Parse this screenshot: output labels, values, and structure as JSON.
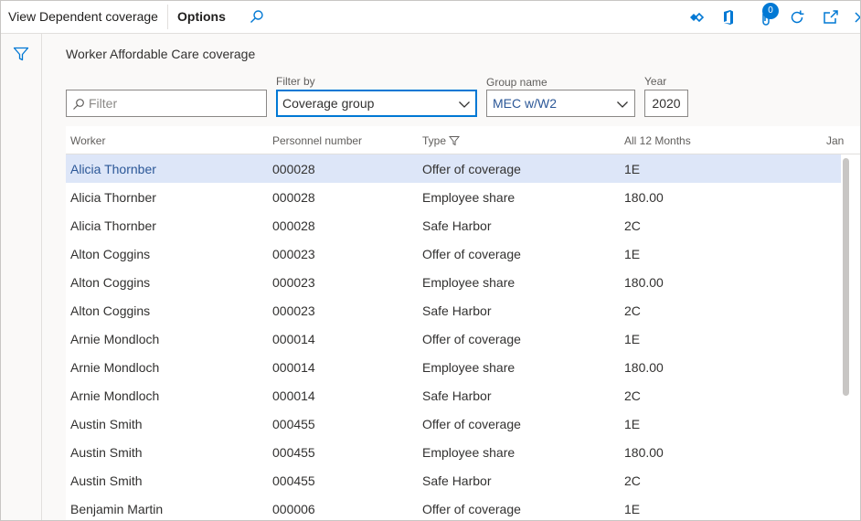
{
  "toolbar": {
    "view_dependent_label": "View Dependent coverage",
    "options_label": "Options",
    "attachments_count": "0"
  },
  "page": {
    "title": "Worker Affordable Care coverage"
  },
  "filters": {
    "filter_placeholder": "Filter",
    "filter_by_label": "Filter by",
    "filter_by_value": "Coverage group",
    "group_name_label": "Group name",
    "group_name_value": "MEC w/W2",
    "year_label": "Year",
    "year_value": "2020"
  },
  "grid": {
    "columns": [
      "Worker",
      "Personnel number",
      "Type",
      "All 12 Months",
      "Jan"
    ],
    "rows": [
      [
        "Alicia Thornber",
        "000028",
        "Offer of coverage",
        "1E"
      ],
      [
        "Alicia Thornber",
        "000028",
        "Employee share",
        "180.00"
      ],
      [
        "Alicia Thornber",
        "000028",
        "Safe Harbor",
        "2C"
      ],
      [
        "Alton Coggins",
        "000023",
        "Offer of coverage",
        "1E"
      ],
      [
        "Alton Coggins",
        "000023",
        "Employee share",
        "180.00"
      ],
      [
        "Alton Coggins",
        "000023",
        "Safe Harbor",
        "2C"
      ],
      [
        "Arnie Mondloch",
        "000014",
        "Offer of coverage",
        "1E"
      ],
      [
        "Arnie Mondloch",
        "000014",
        "Employee share",
        "180.00"
      ],
      [
        "Arnie Mondloch",
        "000014",
        "Safe Harbor",
        "2C"
      ],
      [
        "Austin Smith",
        "000455",
        "Offer of coverage",
        "1E"
      ],
      [
        "Austin Smith",
        "000455",
        "Employee share",
        "180.00"
      ],
      [
        "Austin Smith",
        "000455",
        "Safe Harbor",
        "2C"
      ],
      [
        "Benjamin Martin",
        "000006",
        "Offer of coverage",
        "1E"
      ]
    ],
    "selected_row": 0
  },
  "colors": {
    "accent": "#0078d4",
    "selected_row": "#dde6f8",
    "link_text": "#2b5797"
  }
}
